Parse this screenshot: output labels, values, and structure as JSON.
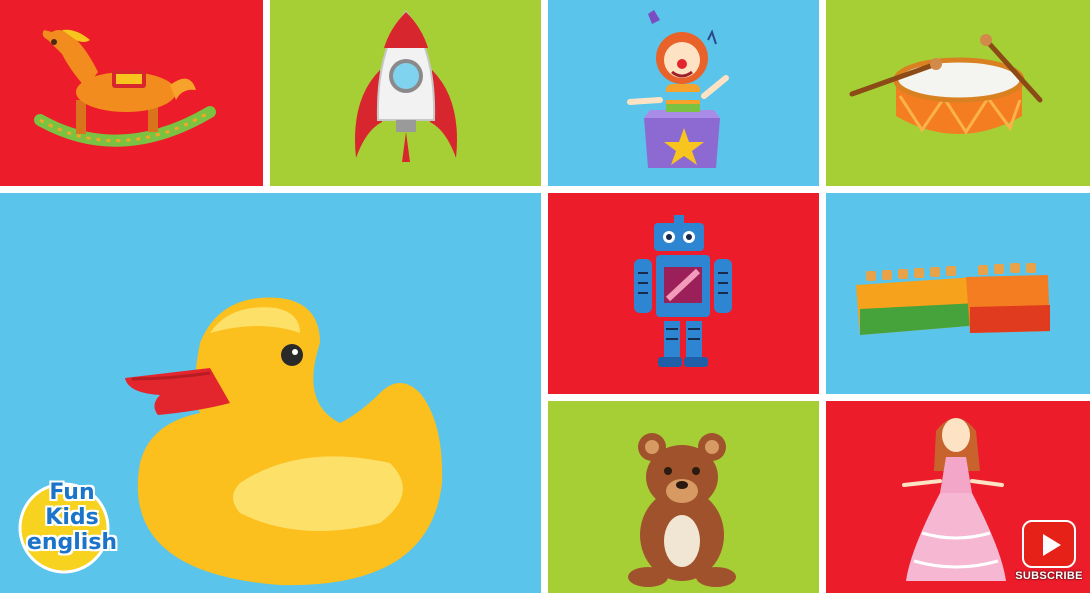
{
  "logo": {
    "line1": "Fun",
    "line2": "Kids",
    "line3": "english"
  },
  "subscribe": {
    "label": "SUBSCRIBE",
    "icon": "youtube-play-icon"
  },
  "colors": {
    "red": "#ec1c2a",
    "green": "#a6cf35",
    "blue": "#5bc4ea"
  },
  "tiles": [
    {
      "name": "rocking-horse",
      "color": "red"
    },
    {
      "name": "rocket",
      "color": "green"
    },
    {
      "name": "jack-in-the-box",
      "color": "blue"
    },
    {
      "name": "drum",
      "color": "green"
    },
    {
      "name": "rubber-duck",
      "color": "blue"
    },
    {
      "name": "robot",
      "color": "red"
    },
    {
      "name": "building-blocks",
      "color": "blue"
    },
    {
      "name": "teddy-bear",
      "color": "green"
    },
    {
      "name": "doll",
      "color": "red"
    }
  ]
}
